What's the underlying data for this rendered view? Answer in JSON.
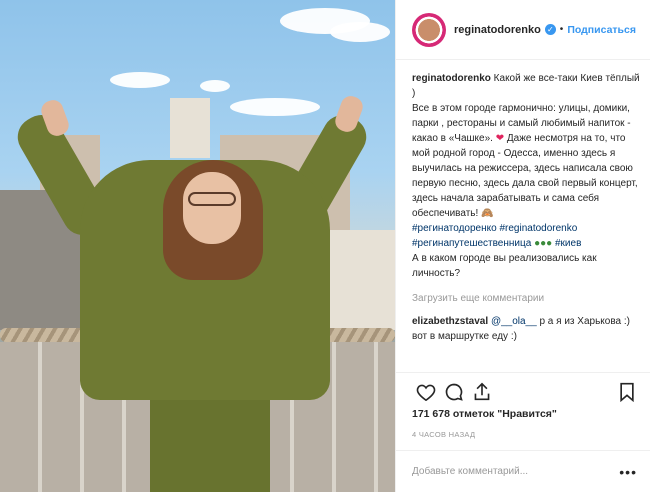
{
  "post": {
    "username": "reginatodorenko",
    "follow_label": "Подписаться",
    "caption_username": "reginatodorenko",
    "caption_line1": " Какой же все-таки Киев тёплый )",
    "caption_body": "Все в этом городе гармонично: улицы, домики, парки , рестораны и самый любимый напиток - какао в «Чашке». ",
    "caption_body2": " Даже несмотря на то, что мой родной город - Одесса, именно здесь я выучилась на режиссера, здесь написала свою первую песню, здесь дала свой первый концерт, здесь начала зарабатывать и сама себя обеспечивать! ",
    "hashtags_line1": "#регинатодоренко #reginatodorenko",
    "hashtags_line2": "#регинапутешественница",
    "hashtag_kiev": "#киев",
    "caption_question": "А в каком городе вы реализовались как личность?",
    "load_more_label": "Загрузить еще комментарии",
    "comment": {
      "username": "elizabethzstaval",
      "mention": "@__ola__",
      "text": "р а я из Харькова :) вот в маршрутке еду :)"
    },
    "likes": "171 678 отметок \"Нравится\"",
    "time_ago": "4 ЧАСОВ НАЗАД",
    "add_comment_placeholder": "Добавьте комментарий...",
    "more_label": "•••"
  },
  "colors": {
    "link": "#3897f0",
    "hashtag": "#003569",
    "heart": "#e0245e"
  }
}
